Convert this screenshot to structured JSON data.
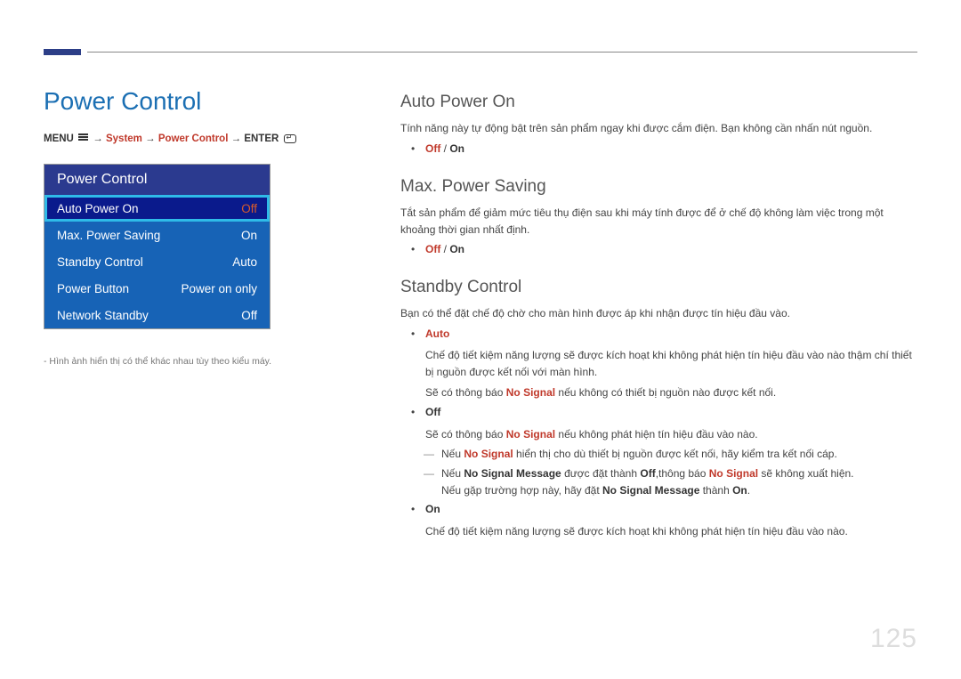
{
  "page_title": "Power Control",
  "breadcrumb": {
    "menu": "MENU",
    "system": "System",
    "power_control": "Power Control",
    "enter": "ENTER",
    "arrow": "→"
  },
  "menu_panel": {
    "header": "Power Control",
    "rows": [
      {
        "label": "Auto Power On",
        "value": "Off",
        "selected": true
      },
      {
        "label": "Max. Power Saving",
        "value": "On",
        "selected": false
      },
      {
        "label": "Standby Control",
        "value": "Auto",
        "selected": false
      },
      {
        "label": "Power Button",
        "value": "Power on only",
        "selected": false
      },
      {
        "label": "Network Standby",
        "value": "Off",
        "selected": false
      }
    ]
  },
  "note_prefix": "- ",
  "note": "Hình ảnh hiển thị có thể khác nhau tùy theo kiểu máy.",
  "sections": {
    "auto_power_on": {
      "title": "Auto Power On",
      "desc": "Tính năng này tự động bật trên sản phẩm ngay khi được cắm điện. Bạn không cần nhấn nút nguồn.",
      "opt_off": "Off",
      "sep": " / ",
      "opt_on": "On"
    },
    "max_power_saving": {
      "title": "Max. Power Saving",
      "desc": "Tắt sản phẩm để giảm mức tiêu thụ điện sau khi máy tính được để ở chế độ không làm việc trong một khoảng thời gian nhất định.",
      "opt_off": "Off",
      "sep": " / ",
      "opt_on": "On"
    },
    "standby_control": {
      "title": "Standby Control",
      "desc": "Bạn có thể đặt chế độ chờ cho màn hình được áp khi nhận được tín hiệu đầu vào.",
      "auto_label": "Auto",
      "auto_p1": "Chế độ tiết kiệm năng lượng sẽ được kích hoạt khi không phát hiện tín hiệu đầu vào nào thậm chí thiết bị nguồn được kết nối với màn hình.",
      "auto_p2_a": "Sẽ có thông báo ",
      "auto_p2_nosignal": "No Signal",
      "auto_p2_b": " nếu không có thiết bị nguồn nào được kết nối.",
      "off_label": "Off",
      "off_p1_a": "Sẽ có thông báo ",
      "off_p1_nosignal": "No Signal",
      "off_p1_b": " nếu không phát hiện tín hiệu đầu vào nào.",
      "off_dash1_a": "Nếu ",
      "off_dash1_nosignal": "No Signal",
      "off_dash1_b": " hiển thị cho dù thiết bị nguồn được kết nối, hãy kiểm tra kết nối cáp.",
      "off_dash2_a": "Nếu ",
      "off_dash2_nsm": "No Signal Message",
      "off_dash2_b": " được đặt thành ",
      "off_dash2_off": "Off",
      "off_dash2_c": ",thông báo ",
      "off_dash2_nosignal": "No Signal",
      "off_dash2_d": " sẽ không xuất hiện.",
      "off_dash3_a": "Nếu gặp trường hợp này, hãy đặt ",
      "off_dash3_nsm": "No Signal Message",
      "off_dash3_b": " thành ",
      "off_dash3_on": "On",
      "off_dash3_c": ".",
      "on_label": "On",
      "on_p": "Chế độ tiết kiệm năng lượng sẽ được kích hoạt khi không phát hiện tín hiệu đầu vào nào."
    }
  },
  "page_number": "125"
}
